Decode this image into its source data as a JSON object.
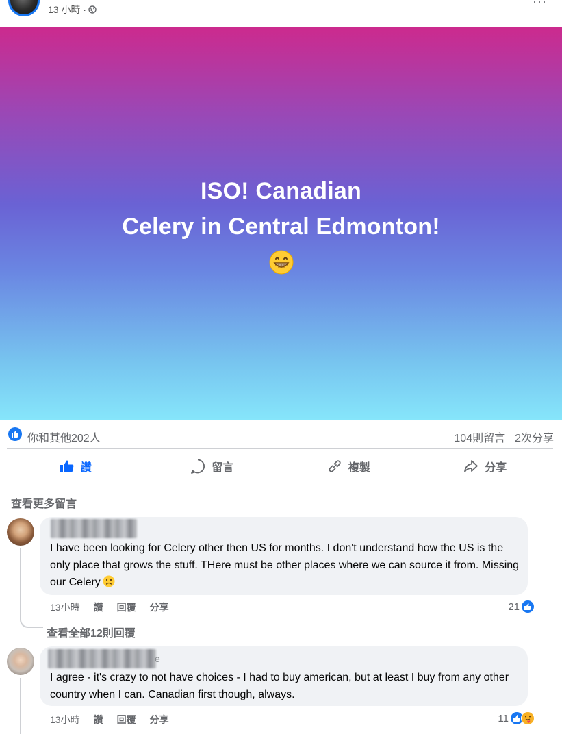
{
  "post": {
    "time": "13 小時 · ",
    "more_icon": "more-dots-icon"
  },
  "banner": {
    "line1": "ISO! Canadian",
    "line2": "Celery in Central Edmonton!",
    "emoji": "grinning-face",
    "gradient": [
      "#cc2a8e",
      "#6a62d4",
      "#86e6fb"
    ]
  },
  "stats": {
    "likes": "你和其他202人",
    "comments": "104則留言",
    "shares": "2次分享"
  },
  "actions": {
    "like": "讚",
    "comment": "留言",
    "copy": "複製",
    "share": "分享"
  },
  "comments_section": {
    "view_more": "查看更多留言",
    "items": [
      {
        "text": "I have been looking for Celery other then US for months. I don't understand how the US is the only place that grows the stuff. THere must be other places where we can source it from. Missing our Celery",
        "time": "13小時",
        "like": "讚",
        "reply": "回覆",
        "share": "分享",
        "reaction_count": "21",
        "view_replies": "查看全部12則回覆"
      },
      {
        "name_tail": "e",
        "text": "I agree - it's crazy to not have choices - I had to buy american, but at least I buy from any other country when I can. Canadian first though, always.",
        "time": "13小時",
        "like": "讚",
        "reply": "回覆",
        "share": "分享",
        "reaction_count": "11"
      }
    ]
  },
  "colors": {
    "facebook_blue": "#0866ff",
    "secondary_text": "#65676b",
    "bubble_bg": "#f0f2f5"
  }
}
